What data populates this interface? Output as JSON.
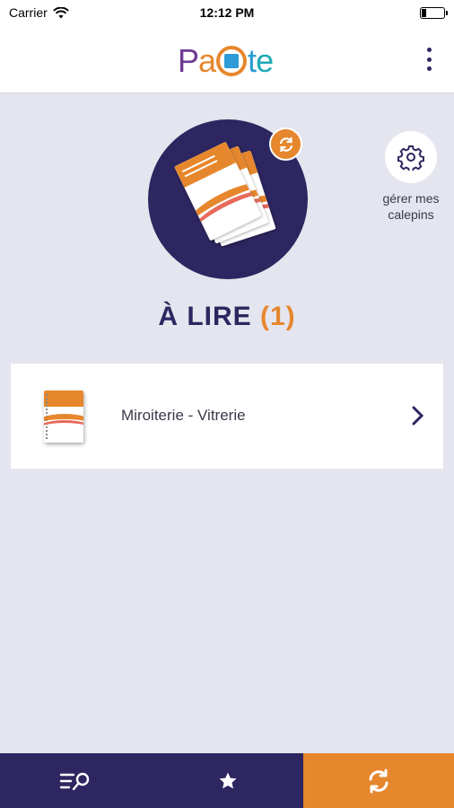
{
  "status_bar": {
    "carrier": "Carrier",
    "time": "12:12 PM"
  },
  "header": {
    "logo_text": "PaCte",
    "logo_parts": [
      "P",
      "a",
      "t",
      "e"
    ],
    "menu_icon": "kebab-menu-icon"
  },
  "hero": {
    "sync_icon": "sync-icon",
    "manage_label": "gérer mes calepins",
    "manage_icon": "gear-icon"
  },
  "section": {
    "title": "À LIRE",
    "count": "(1)"
  },
  "list": {
    "items": [
      {
        "label": "Miroiterie - Vitrerie",
        "icon": "notebook-thumbnail"
      }
    ]
  },
  "tabbar": {
    "tabs": [
      {
        "icon": "list-search-icon"
      },
      {
        "icon": "star-icon"
      },
      {
        "icon": "sync-icon"
      }
    ]
  },
  "colors": {
    "navy": "#2d2660",
    "orange": "#e6872d",
    "background": "#e4e5ee"
  }
}
